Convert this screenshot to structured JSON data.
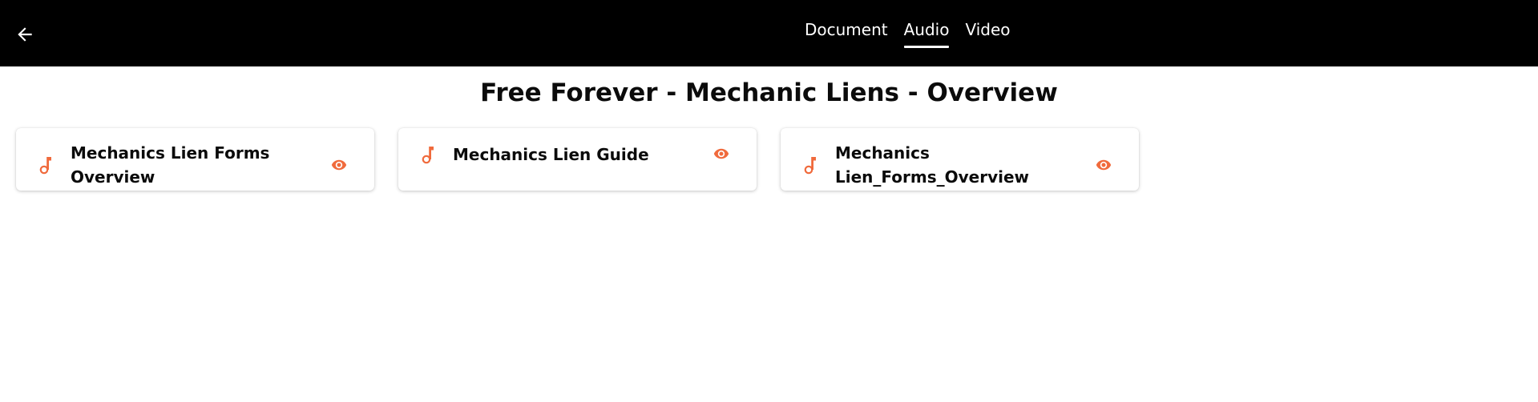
{
  "header": {
    "back_icon": "arrow-left-icon",
    "tabs": [
      {
        "label": "Document",
        "active": false
      },
      {
        "label": "Audio",
        "active": true
      },
      {
        "label": "Video",
        "active": false
      }
    ]
  },
  "page": {
    "title": "Free Forever - Mechanic Liens - Overview"
  },
  "cards": [
    {
      "title": "Mechanics Lien Forms Overview",
      "type_icon": "music-note-icon",
      "action_icon": "eye-icon"
    },
    {
      "title": "Mechanics Lien Guide",
      "type_icon": "music-note-icon",
      "action_icon": "eye-icon"
    },
    {
      "title": "Mechanics Lien_Forms_Overview",
      "type_icon": "music-note-icon",
      "action_icon": "eye-icon"
    }
  ],
  "colors": {
    "header_bg": "#000000",
    "accent": "#f06a3c",
    "text": "#0b0b0b"
  }
}
